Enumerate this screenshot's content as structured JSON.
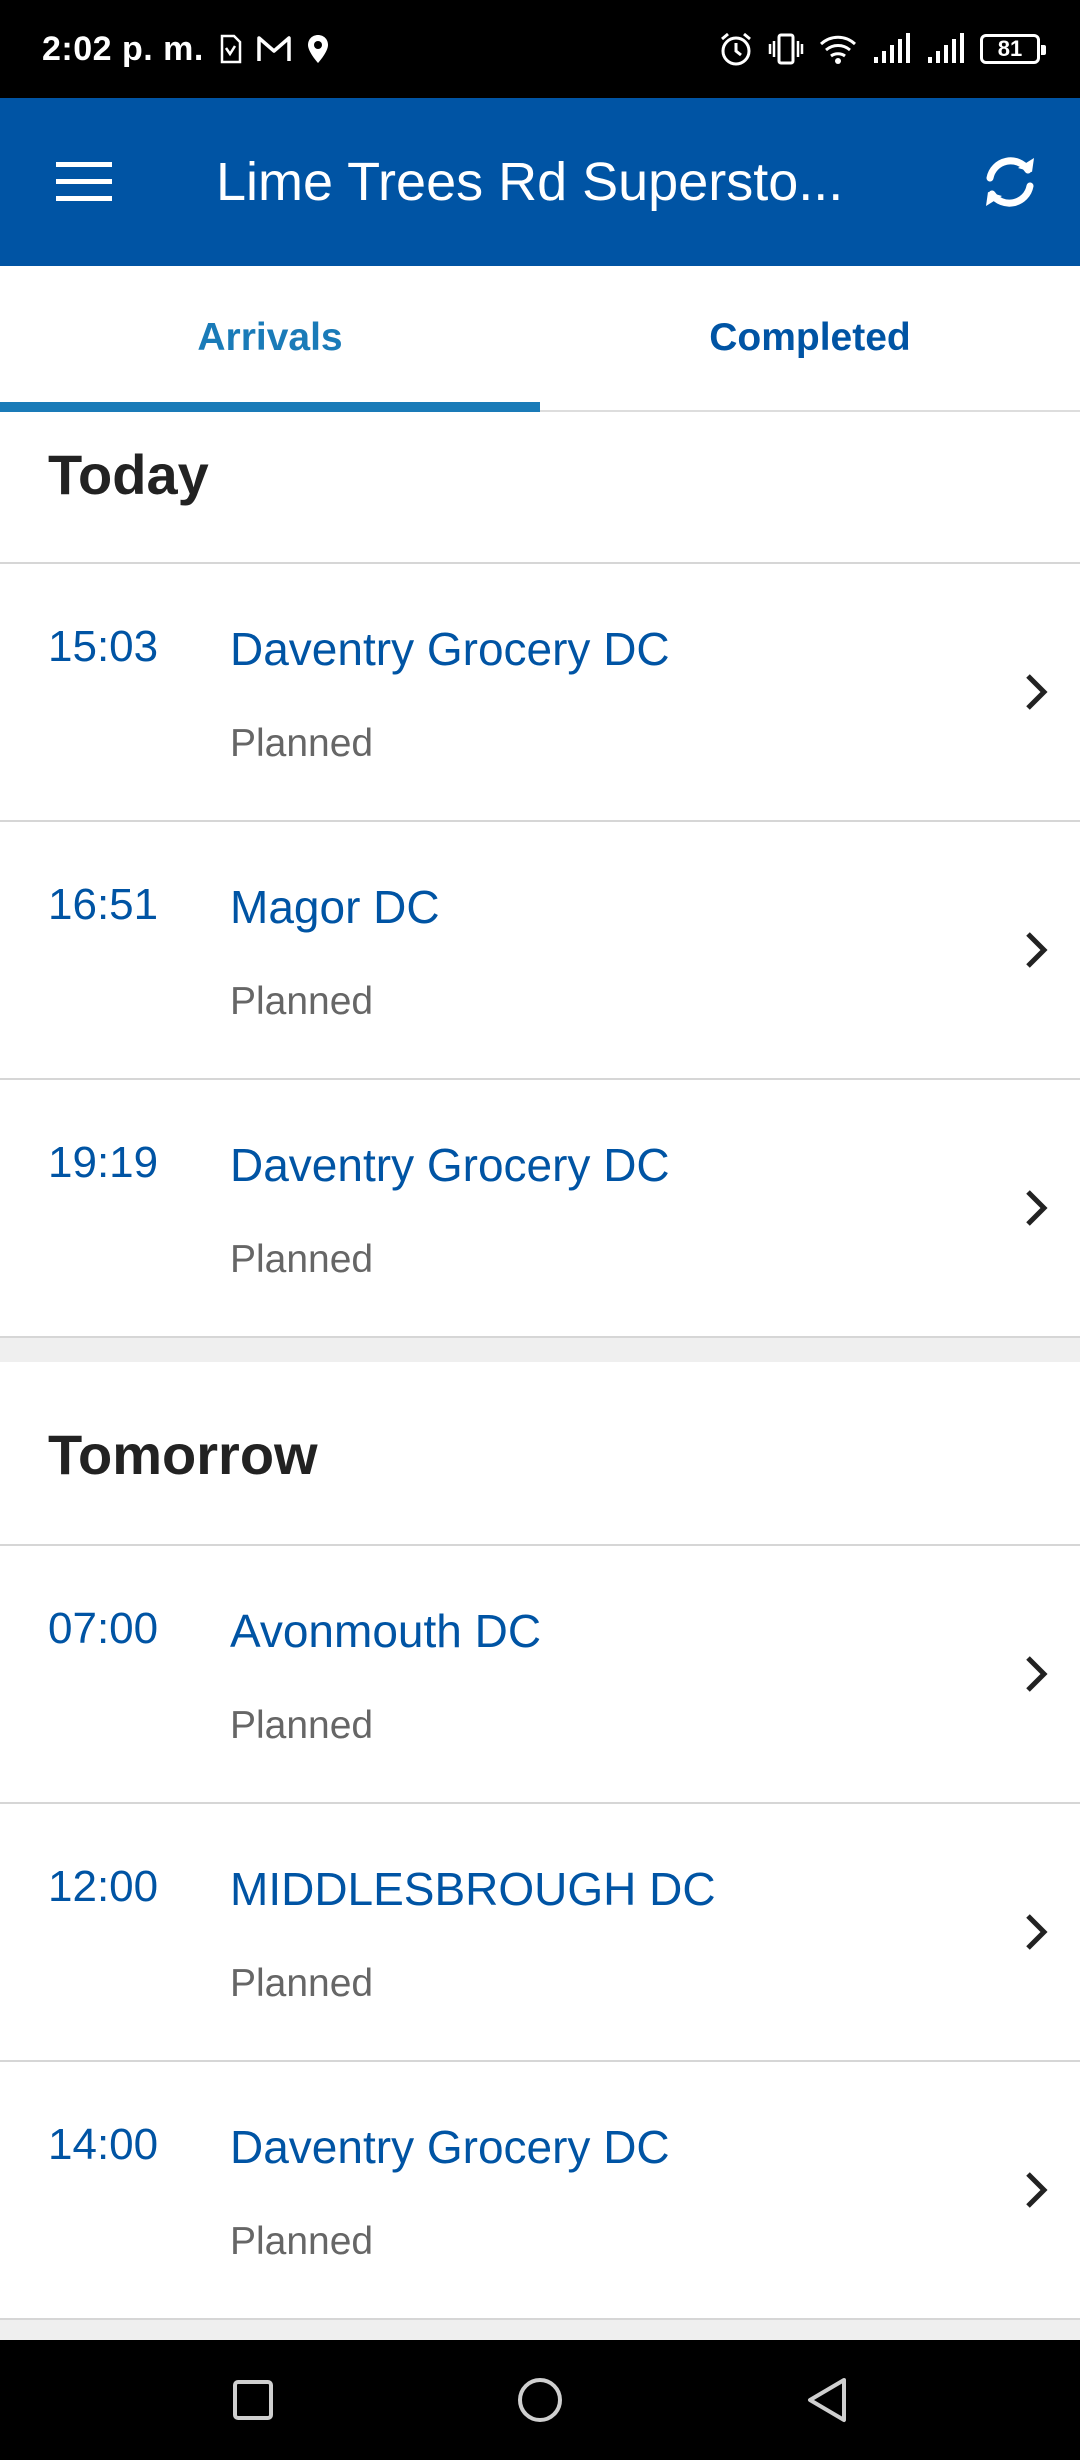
{
  "status_bar": {
    "time": "2:02 p. m.",
    "battery": "81",
    "left_icons": [
      "sim-card-icon",
      "gmail-icon",
      "location-pin-icon"
    ],
    "right_icons": [
      "alarm-icon",
      "vibrate-icon",
      "wifi-icon",
      "signal-icon",
      "signal-icon",
      "battery-icon"
    ]
  },
  "app_bar": {
    "title": "Lime Trees Rd Supersto...",
    "menu_icon": "hamburger-menu-icon",
    "refresh_icon": "refresh-icon",
    "background": "#0054a4"
  },
  "tabs": [
    {
      "label": "Arrivals",
      "active": true
    },
    {
      "label": "Completed",
      "active": false
    }
  ],
  "sections": [
    {
      "title": "Today",
      "items": [
        {
          "time": "15:03",
          "name": "Daventry Grocery DC",
          "status": "Planned"
        },
        {
          "time": "16:51",
          "name": "Magor DC",
          "status": "Planned"
        },
        {
          "time": "19:19",
          "name": "Daventry Grocery DC",
          "status": "Planned"
        }
      ]
    },
    {
      "title": "Tomorrow",
      "items": [
        {
          "time": "07:00",
          "name": "Avonmouth DC",
          "status": "Planned"
        },
        {
          "time": "12:00",
          "name": "MIDDLESBROUGH DC",
          "status": "Planned"
        },
        {
          "time": "14:00",
          "name": "Daventry Grocery DC",
          "status": "Planned"
        }
      ]
    }
  ],
  "nav_bar": {
    "buttons": [
      "recents-square-icon",
      "home-circle-icon",
      "back-triangle-icon"
    ]
  },
  "colors": {
    "accent": "#0054a4",
    "tab_active": "#1a7bb8",
    "status_text": "#666666"
  }
}
